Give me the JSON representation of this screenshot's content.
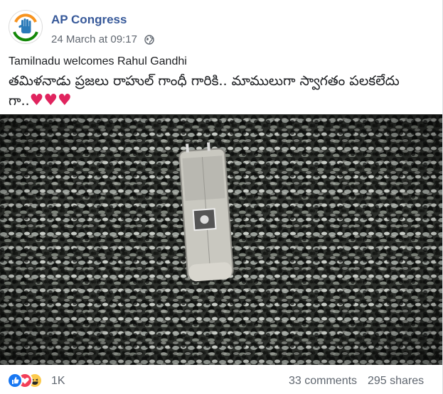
{
  "page": {
    "name": "AP Congress",
    "timestamp": "24 March at 09:17",
    "privacy_icon": "globe-icon",
    "avatar_icon": "congress-hand-logo"
  },
  "post": {
    "text_en": "Tamilnadu welcomes Rahul Gandhi",
    "text_te": "తమిళనాడు ప్రజలు రాహుల్ గాంధీ గారికి.. మాములుగా స్వాగతం పలకలేదు గా..",
    "hearts": "♥♥♥",
    "photo_description_icon": "crowd-photo"
  },
  "footer": {
    "reaction_icons": [
      "like-icon",
      "love-icon",
      "haha-icon"
    ],
    "reaction_count": "1K",
    "comments": "33 comments",
    "shares": "295 shares"
  },
  "colors": {
    "link": "#365899",
    "meta": "#606770",
    "like": "#1877f2",
    "love": "#f33e58",
    "haha": "#fcca4d",
    "heart": "#e0245e"
  }
}
